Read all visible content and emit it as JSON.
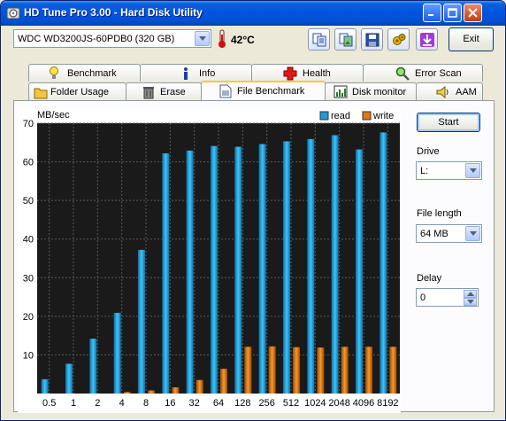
{
  "window": {
    "title": "HD Tune Pro 3.00 - Hard Disk Utility",
    "accent": "#0254e0"
  },
  "toolbar": {
    "drive": "WDC WD3200JS-60PDB0 (320 GB)",
    "temperature": "42°C",
    "exit_label": "Exit",
    "icons": [
      "copy-text-icon",
      "copy-screenshot-icon",
      "save-icon",
      "options-icon",
      "minimize-tray-icon"
    ]
  },
  "tabs_row1": [
    {
      "label": "Benchmark",
      "icon": "benchmark-icon"
    },
    {
      "label": "Info",
      "icon": "info-icon"
    },
    {
      "label": "Health",
      "icon": "health-icon"
    },
    {
      "label": "Error Scan",
      "icon": "error-scan-icon"
    }
  ],
  "tabs_row2": [
    {
      "label": "Folder Usage",
      "icon": "folder-icon"
    },
    {
      "label": "Erase",
      "icon": "trash-icon"
    },
    {
      "label": "File Benchmark",
      "icon": "file-icon",
      "active": true
    },
    {
      "label": "Disk monitor",
      "icon": "disk-monitor-icon"
    },
    {
      "label": "AAM",
      "icon": "speaker-icon"
    }
  ],
  "side": {
    "start_label": "Start",
    "drive_label": "Drive",
    "drive_value": "L:",
    "file_length_label": "File length",
    "file_length_value": "64 MB",
    "delay_label": "Delay",
    "delay_value": "0"
  },
  "chart_data": {
    "type": "bar",
    "ylabel": "MB/sec",
    "ylim": [
      0,
      70
    ],
    "yticks": [
      "10",
      "20",
      "30",
      "40",
      "50",
      "60",
      "70"
    ],
    "categories": [
      "0.5",
      "1",
      "2",
      "4",
      "8",
      "16",
      "32",
      "64",
      "128",
      "256",
      "512",
      "1024",
      "2048",
      "4096",
      "8192"
    ],
    "series": [
      {
        "name": "read",
        "color": "#1e9bd8",
        "values": [
          3.7,
          7.7,
          14.2,
          20.9,
          37.2,
          62.2,
          62.9,
          64.1,
          63.9,
          64.6,
          65.3,
          65.9,
          66.9,
          63.2,
          67.6
        ]
      },
      {
        "name": "write",
        "color": "#e07a14",
        "values": [
          0,
          0,
          0,
          0.4,
          0.8,
          1.6,
          3.5,
          6.4,
          12.1,
          12.2,
          12.0,
          11.9,
          12.1,
          12.1,
          12.1
        ]
      }
    ],
    "grid": true,
    "legend": "top-right",
    "background": "#1a1a1a"
  }
}
